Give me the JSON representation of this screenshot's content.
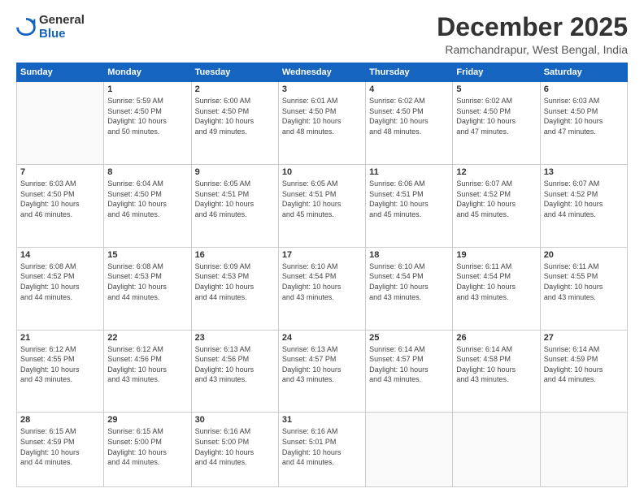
{
  "logo": {
    "general": "General",
    "blue": "Blue"
  },
  "header": {
    "month_year": "December 2025",
    "location": "Ramchandrapur, West Bengal, India"
  },
  "days_of_week": [
    "Sunday",
    "Monday",
    "Tuesday",
    "Wednesday",
    "Thursday",
    "Friday",
    "Saturday"
  ],
  "weeks": [
    [
      {
        "day": "",
        "info": ""
      },
      {
        "day": "1",
        "info": "Sunrise: 5:59 AM\nSunset: 4:50 PM\nDaylight: 10 hours\nand 50 minutes."
      },
      {
        "day": "2",
        "info": "Sunrise: 6:00 AM\nSunset: 4:50 PM\nDaylight: 10 hours\nand 49 minutes."
      },
      {
        "day": "3",
        "info": "Sunrise: 6:01 AM\nSunset: 4:50 PM\nDaylight: 10 hours\nand 48 minutes."
      },
      {
        "day": "4",
        "info": "Sunrise: 6:02 AM\nSunset: 4:50 PM\nDaylight: 10 hours\nand 48 minutes."
      },
      {
        "day": "5",
        "info": "Sunrise: 6:02 AM\nSunset: 4:50 PM\nDaylight: 10 hours\nand 47 minutes."
      },
      {
        "day": "6",
        "info": "Sunrise: 6:03 AM\nSunset: 4:50 PM\nDaylight: 10 hours\nand 47 minutes."
      }
    ],
    [
      {
        "day": "7",
        "info": "Sunrise: 6:03 AM\nSunset: 4:50 PM\nDaylight: 10 hours\nand 46 minutes."
      },
      {
        "day": "8",
        "info": "Sunrise: 6:04 AM\nSunset: 4:50 PM\nDaylight: 10 hours\nand 46 minutes."
      },
      {
        "day": "9",
        "info": "Sunrise: 6:05 AM\nSunset: 4:51 PM\nDaylight: 10 hours\nand 46 minutes."
      },
      {
        "day": "10",
        "info": "Sunrise: 6:05 AM\nSunset: 4:51 PM\nDaylight: 10 hours\nand 45 minutes."
      },
      {
        "day": "11",
        "info": "Sunrise: 6:06 AM\nSunset: 4:51 PM\nDaylight: 10 hours\nand 45 minutes."
      },
      {
        "day": "12",
        "info": "Sunrise: 6:07 AM\nSunset: 4:52 PM\nDaylight: 10 hours\nand 45 minutes."
      },
      {
        "day": "13",
        "info": "Sunrise: 6:07 AM\nSunset: 4:52 PM\nDaylight: 10 hours\nand 44 minutes."
      }
    ],
    [
      {
        "day": "14",
        "info": "Sunrise: 6:08 AM\nSunset: 4:52 PM\nDaylight: 10 hours\nand 44 minutes."
      },
      {
        "day": "15",
        "info": "Sunrise: 6:08 AM\nSunset: 4:53 PM\nDaylight: 10 hours\nand 44 minutes."
      },
      {
        "day": "16",
        "info": "Sunrise: 6:09 AM\nSunset: 4:53 PM\nDaylight: 10 hours\nand 44 minutes."
      },
      {
        "day": "17",
        "info": "Sunrise: 6:10 AM\nSunset: 4:54 PM\nDaylight: 10 hours\nand 43 minutes."
      },
      {
        "day": "18",
        "info": "Sunrise: 6:10 AM\nSunset: 4:54 PM\nDaylight: 10 hours\nand 43 minutes."
      },
      {
        "day": "19",
        "info": "Sunrise: 6:11 AM\nSunset: 4:54 PM\nDaylight: 10 hours\nand 43 minutes."
      },
      {
        "day": "20",
        "info": "Sunrise: 6:11 AM\nSunset: 4:55 PM\nDaylight: 10 hours\nand 43 minutes."
      }
    ],
    [
      {
        "day": "21",
        "info": "Sunrise: 6:12 AM\nSunset: 4:55 PM\nDaylight: 10 hours\nand 43 minutes."
      },
      {
        "day": "22",
        "info": "Sunrise: 6:12 AM\nSunset: 4:56 PM\nDaylight: 10 hours\nand 43 minutes."
      },
      {
        "day": "23",
        "info": "Sunrise: 6:13 AM\nSunset: 4:56 PM\nDaylight: 10 hours\nand 43 minutes."
      },
      {
        "day": "24",
        "info": "Sunrise: 6:13 AM\nSunset: 4:57 PM\nDaylight: 10 hours\nand 43 minutes."
      },
      {
        "day": "25",
        "info": "Sunrise: 6:14 AM\nSunset: 4:57 PM\nDaylight: 10 hours\nand 43 minutes."
      },
      {
        "day": "26",
        "info": "Sunrise: 6:14 AM\nSunset: 4:58 PM\nDaylight: 10 hours\nand 43 minutes."
      },
      {
        "day": "27",
        "info": "Sunrise: 6:14 AM\nSunset: 4:59 PM\nDaylight: 10 hours\nand 44 minutes."
      }
    ],
    [
      {
        "day": "28",
        "info": "Sunrise: 6:15 AM\nSunset: 4:59 PM\nDaylight: 10 hours\nand 44 minutes."
      },
      {
        "day": "29",
        "info": "Sunrise: 6:15 AM\nSunset: 5:00 PM\nDaylight: 10 hours\nand 44 minutes."
      },
      {
        "day": "30",
        "info": "Sunrise: 6:16 AM\nSunset: 5:00 PM\nDaylight: 10 hours\nand 44 minutes."
      },
      {
        "day": "31",
        "info": "Sunrise: 6:16 AM\nSunset: 5:01 PM\nDaylight: 10 hours\nand 44 minutes."
      },
      {
        "day": "",
        "info": ""
      },
      {
        "day": "",
        "info": ""
      },
      {
        "day": "",
        "info": ""
      }
    ]
  ]
}
